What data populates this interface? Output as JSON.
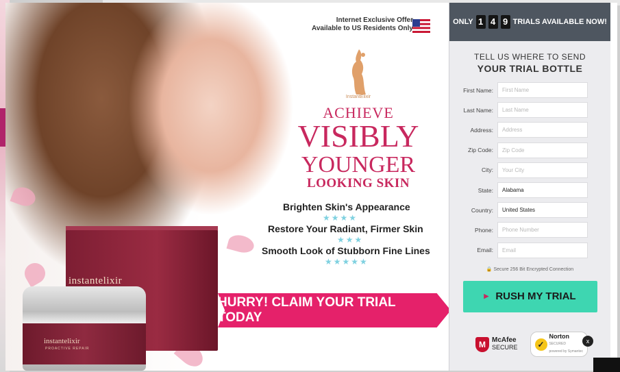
{
  "offer": {
    "line1": "Internet Exclusive Offer",
    "line2": "Available to US Residents Only",
    "flag_icon": "us-flag-icon"
  },
  "brand": {
    "name": "instantelixir",
    "logo_text": "InstantElixir",
    "jar_subtitle": "PROACTIVE REPAIR",
    "accent_color": "#c8285e"
  },
  "headline": {
    "achieve": "ACHIEVE",
    "visibly": "VISIBLY",
    "younger": "YOUNGER",
    "looking": "LOOKING SKIN"
  },
  "benefits": [
    {
      "text": "Brighten Skin's Appearance",
      "stars": "★★★★"
    },
    {
      "text": "Restore Your Radiant, Firmer Skin",
      "stars": "★★★"
    },
    {
      "text": "Smooth Look of Stubborn Fine Lines",
      "stars": "★★★★★"
    }
  ],
  "cta_banner": "HURRY! CLAIM YOUR TRIAL TODAY",
  "panel": {
    "only_label": "ONLY",
    "digits": [
      "1",
      "4",
      "9"
    ],
    "trials_label": "TRIALS AVAILABLE NOW!",
    "title_line1": "TELL US WHERE TO SEND",
    "title_line2": "YOUR TRIAL BOTTLE",
    "fields": [
      {
        "label": "First Name:",
        "placeholder": "First Name",
        "value": ""
      },
      {
        "label": "Last Name:",
        "placeholder": "Last Name",
        "value": ""
      },
      {
        "label": "Address:",
        "placeholder": "Address",
        "value": ""
      },
      {
        "label": "Zip Code:",
        "placeholder": "Zip Code",
        "value": ""
      },
      {
        "label": "City:",
        "placeholder": "Your City",
        "value": ""
      },
      {
        "label": "State:",
        "placeholder": "",
        "value": "Alabama"
      },
      {
        "label": "Country:",
        "placeholder": "",
        "value": "United States"
      },
      {
        "label": "Phone:",
        "placeholder": "Phone Number",
        "value": ""
      },
      {
        "label": "Email:",
        "placeholder": "Email",
        "value": ""
      }
    ],
    "secure_text": "Secure 256 Bit Encrypted Connection",
    "rush_button": "RUSH MY TRIAL",
    "mcafee_brand": "McAfee",
    "mcafee_sub": "SECURE",
    "norton_brand": "Norton",
    "norton_sub": "SECURED",
    "norton_powered": "powered by Symantec",
    "accent_button_color": "#3ed6b1"
  },
  "close_label": "x"
}
